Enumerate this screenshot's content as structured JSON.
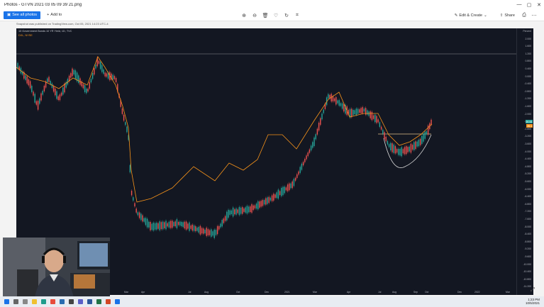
{
  "window": {
    "title": "Photos - GTVN 2021 03 05 09 39 21.png",
    "controls": [
      "—",
      "▢",
      "✕"
    ]
  },
  "toolbar": {
    "see_all_photos": "See all photos",
    "add_to": "Add to",
    "edit_create": "Edit & Create",
    "share": "Share"
  },
  "chart": {
    "published_by": "Snapshot was published on TradingView.com, Oct 05, 2021 14:23 UTC-4",
    "info_line1": "10 Government Bonds 10 YR Yield, 1D, TVC",
    "info_line2_orange": "DXL, NYSE",
    "y_ticks": [
      "Percent",
      "2.000",
      "1.600",
      "1.200",
      "0.800",
      "0.400",
      "0.000",
      "-0.400",
      "-0.800",
      "-1.200",
      "-1.600",
      "-2.000",
      "-2.400",
      "-2.800",
      "-3.200",
      "-3.600",
      "-4.000",
      "-4.400",
      "-4.800",
      "-5.200",
      "-5.600",
      "-6.000",
      "-6.400",
      "-6.800",
      "-7.200",
      "-7.600",
      "-8.000",
      "-8.400",
      "-8.800",
      "-9.200",
      "-9.600",
      "-10.000",
      "-10.400",
      "-10.800",
      "-11.200"
    ],
    "x_ticks": [
      "Mar",
      "Apr",
      "Jul",
      "Aug",
      "Oct",
      "Dec",
      "2021",
      "Mar",
      "Apr",
      "Jul",
      "Aug",
      "Sep",
      "Oct",
      "Dec",
      "2022",
      "Mar"
    ],
    "price_tag_green": "39.08",
    "price_tag_orange": "39.1"
  },
  "taskbar": {
    "time": "1:23 PM",
    "date": "10/5/2021"
  },
  "colors": {
    "chart_bg": "#131722",
    "line_orange": "#f7931a",
    "candle_up": "#26a69a",
    "candle_down": "#ef5350",
    "accent_blue": "#1a73e8"
  }
}
